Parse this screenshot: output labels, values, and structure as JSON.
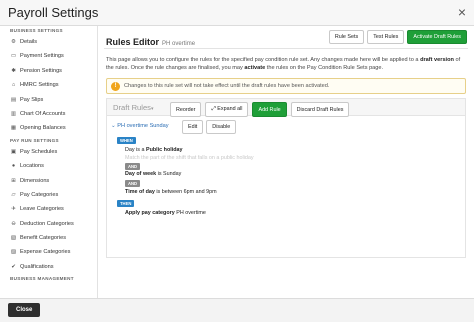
{
  "window": {
    "title": "Payroll Settings",
    "close_glyph": "×"
  },
  "sidebar": {
    "sections": [
      {
        "header": "BUSINESS SETTINGS",
        "items": [
          {
            "label": "Details",
            "icon": "gear-icon",
            "glyph": "⚙"
          },
          {
            "label": "Payment Settings",
            "icon": "card-icon",
            "glyph": "▭"
          },
          {
            "label": "Pension Settings",
            "icon": "pension-icon",
            "glyph": "✱"
          },
          {
            "label": "HMRC Settings",
            "icon": "bank-icon",
            "glyph": "⌂"
          },
          {
            "label": "Pay Slips",
            "icon": "file-icon",
            "glyph": "▤"
          },
          {
            "label": "Chart Of Accounts",
            "icon": "book-icon",
            "glyph": "▥"
          },
          {
            "label": "Opening Balances",
            "icon": "balance-icon",
            "glyph": "▦"
          }
        ]
      },
      {
        "header": "PAY RUN SETTINGS",
        "items": [
          {
            "label": "Pay Schedules",
            "icon": "calendar-icon",
            "glyph": "▣"
          },
          {
            "label": "Locations",
            "icon": "map-pin-icon",
            "glyph": "●"
          },
          {
            "label": "Dimensions",
            "icon": "sliders-icon",
            "glyph": "⊞"
          },
          {
            "label": "Pay Categories",
            "icon": "folder-icon",
            "glyph": "▱"
          },
          {
            "label": "Leave Categories",
            "icon": "plane-icon",
            "glyph": "✈"
          },
          {
            "label": "Deduction Categories",
            "icon": "minus-circle-icon",
            "glyph": "⊖"
          },
          {
            "label": "Benefit Categories",
            "icon": "gift-icon",
            "glyph": "▧"
          },
          {
            "label": "Expense Categories",
            "icon": "receipt-icon",
            "glyph": "▨"
          },
          {
            "label": "Qualifications",
            "icon": "check-icon",
            "glyph": "✔"
          }
        ]
      },
      {
        "header": "BUSINESS MANAGEMENT",
        "items": []
      }
    ]
  },
  "header": {
    "title": "Rules Editor",
    "subtitle": "PH overtime",
    "buttons": [
      "Rule Sets",
      "Test Rules",
      "Activate Draft Rules"
    ]
  },
  "description": {
    "part1": "This page allows you to configure the rules for the specified pay condition rule set. Any changes made here will be applied to a ",
    "bold1": "draft version",
    "part2": " of the rules. Once the rule changes are finalised, you may ",
    "bold2": "activate",
    "part3": " the rules on the Pay Condition Rule Sets page."
  },
  "notice": {
    "icon": "warning-icon",
    "glyph": "!",
    "text": "Changes to this rule set will not take effect until the draft rules have been activated."
  },
  "toolbar": {
    "dropdown": "Draft Rules",
    "caret": "▾",
    "reorder": "Reorder",
    "expand_all": "⤢ Expand all",
    "add_rule": "Add Rule",
    "discard": "Discard Draft Rules"
  },
  "rule": {
    "name": "⌄ PH overtime Sunday",
    "edit": "Edit",
    "disable": "Disable",
    "when_tag": "WHEN",
    "cond1_prefix": "Day is a ",
    "cond1_bold": "Public holiday",
    "cond_faded": "Match the part of the shift that falls on a public holiday",
    "and_tag": "AND",
    "cond2_bold": "Day of week",
    "cond2_suffix": " is Sunday",
    "cond3_bold": "Time of day",
    "cond3_suffix": " is between 6pm and 9pm",
    "then_tag": "THEN",
    "action_bold": "Apply pay category",
    "action_suffix": " PH overtime"
  },
  "footer": {
    "close": "Close"
  }
}
